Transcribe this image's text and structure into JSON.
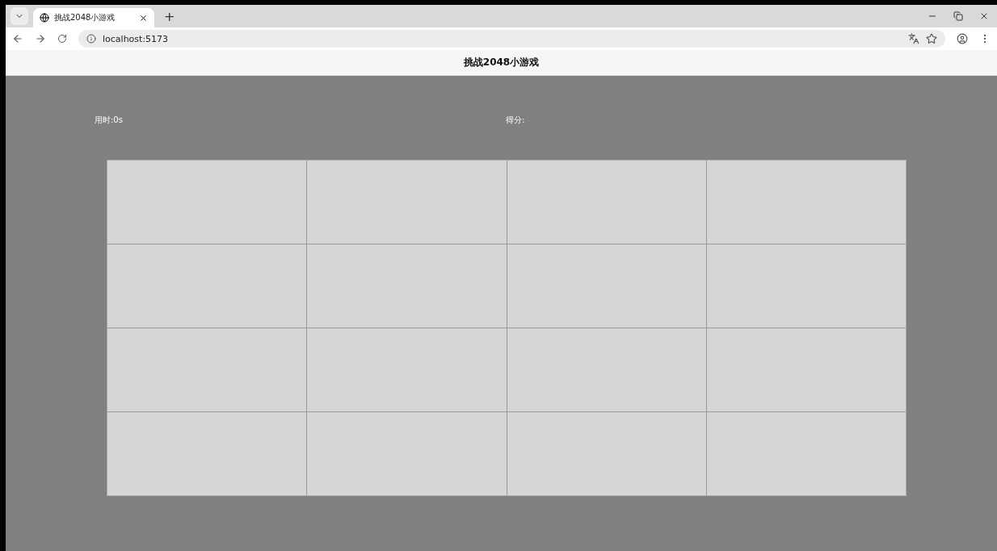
{
  "browser": {
    "tab": {
      "title": "挑战2048小游戏",
      "selected": true
    },
    "new_tab": "+",
    "address": "localhost:5173"
  },
  "page": {
    "title": "挑战2048小游戏",
    "time": "用时:0s",
    "score": "得分:"
  }
}
